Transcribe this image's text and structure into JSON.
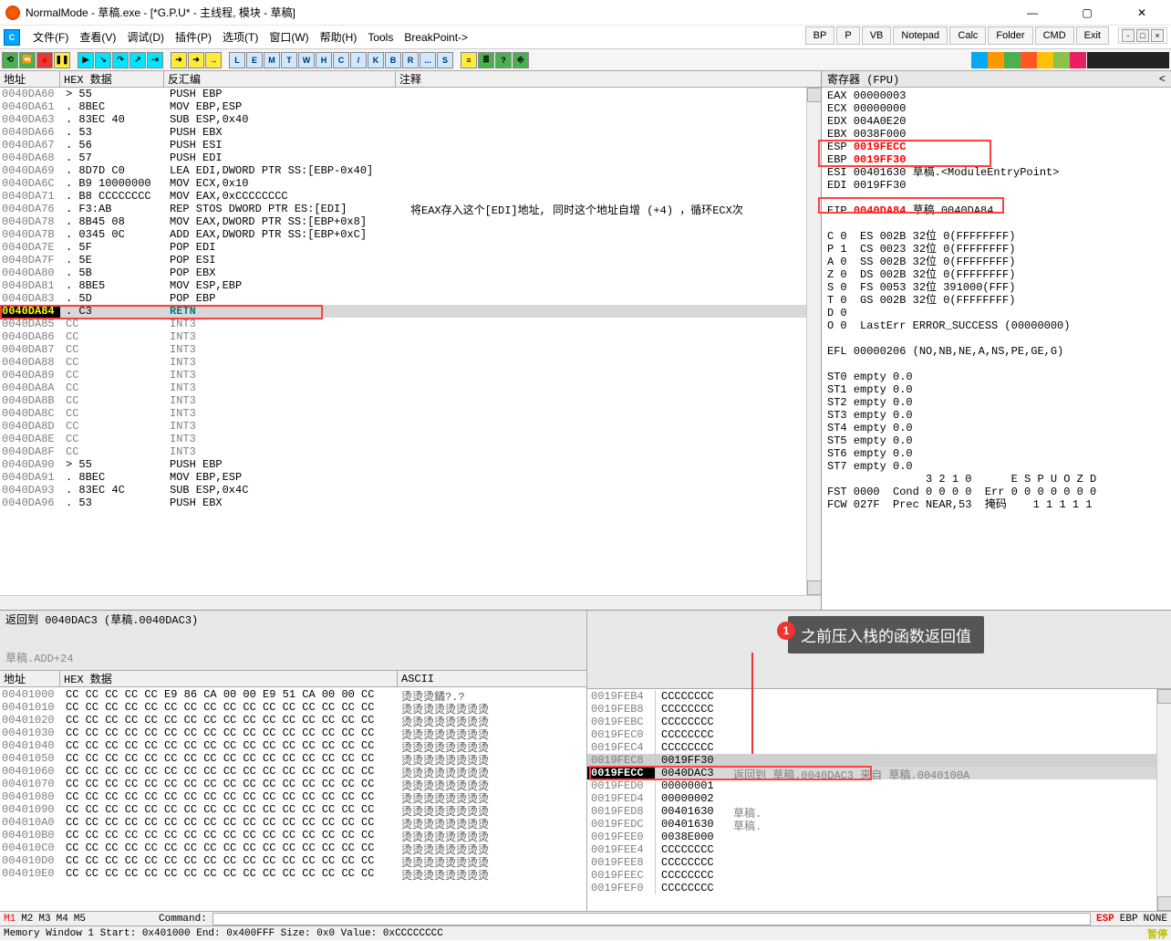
{
  "title": "NormalMode - 草稿.exe - [*G.P.U* - 主线程, 模块 - 草稿]",
  "menu": {
    "file": "文件(F)",
    "view": "查看(V)",
    "debug": "调试(D)",
    "plugin": "插件(P)",
    "options": "选项(T)",
    "window": "窗口(W)",
    "help": "帮助(H)",
    "tools": "Tools",
    "bp": "BreakPoint->"
  },
  "buttons": {
    "bp": "BP",
    "p": "P",
    "vb": "VB",
    "notepad": "Notepad",
    "calc": "Calc",
    "folder": "Folder",
    "cmd": "CMD",
    "exit": "Exit"
  },
  "tbletters": [
    "L",
    "E",
    "M",
    "T",
    "W",
    "H",
    "C",
    "/",
    "K",
    "B",
    "R",
    "...",
    "S"
  ],
  "headers": {
    "addr": "地址",
    "hex": "HEX 数据",
    "disasm": "反汇编",
    "comment": "注释",
    "reg": "寄存器 (FPU)",
    "ascii": "ASCII"
  },
  "comment0": "将EAX存入这个[EDI]地址, 同时这个地址自增 (+4) ，循环ECX次",
  "disasm": [
    {
      "a": "0040DA60",
      "h": "> 55",
      "d": "PUSH EBP"
    },
    {
      "a": "0040DA61",
      "h": ". 8BEC",
      "d": "MOV EBP,ESP"
    },
    {
      "a": "0040DA63",
      "h": ". 83EC 40",
      "d": "SUB ESP,0x40"
    },
    {
      "a": "0040DA66",
      "h": ". 53",
      "d": "PUSH EBX"
    },
    {
      "a": "0040DA67",
      "h": ". 56",
      "d": "PUSH ESI"
    },
    {
      "a": "0040DA68",
      "h": ". 57",
      "d": "PUSH EDI"
    },
    {
      "a": "0040DA69",
      "h": ". 8D7D C0",
      "d": "LEA EDI,DWORD PTR SS:[EBP-0x40]"
    },
    {
      "a": "0040DA6C",
      "h": ". B9 10000000",
      "d": "MOV ECX,0x10"
    },
    {
      "a": "0040DA71",
      "h": ". B8 CCCCCCCC",
      "d": "MOV EAX,0xCCCCCCCC"
    },
    {
      "a": "0040DA76",
      "h": ". F3:AB",
      "d": "REP STOS DWORD PTR ES:[EDI]"
    },
    {
      "a": "0040DA78",
      "h": ". 8B45 08",
      "d": "MOV EAX,DWORD PTR SS:[EBP+0x8]"
    },
    {
      "a": "0040DA7B",
      "h": ". 0345 0C",
      "d": "ADD EAX,DWORD PTR SS:[EBP+0xC]"
    },
    {
      "a": "0040DA7E",
      "h": ". 5F",
      "d": "POP EDI"
    },
    {
      "a": "0040DA7F",
      "h": ". 5E",
      "d": "POP ESI"
    },
    {
      "a": "0040DA80",
      "h": ". 5B",
      "d": "POP EBX"
    },
    {
      "a": "0040DA81",
      "h": ". 8BE5",
      "d": "MOV ESP,EBP"
    },
    {
      "a": "0040DA83",
      "h": ". 5D",
      "d": "POP EBP"
    },
    {
      "a": "0040DA84",
      "h": ". C3",
      "d": "RETN",
      "hl": true
    },
    {
      "a": "0040DA85",
      "h": "  CC",
      "d": "INT3"
    },
    {
      "a": "0040DA86",
      "h": "  CC",
      "d": "INT3"
    },
    {
      "a": "0040DA87",
      "h": "  CC",
      "d": "INT3"
    },
    {
      "a": "0040DA88",
      "h": "  CC",
      "d": "INT3"
    },
    {
      "a": "0040DA89",
      "h": "  CC",
      "d": "INT3"
    },
    {
      "a": "0040DA8A",
      "h": "  CC",
      "d": "INT3"
    },
    {
      "a": "0040DA8B",
      "h": "  CC",
      "d": "INT3"
    },
    {
      "a": "0040DA8C",
      "h": "  CC",
      "d": "INT3"
    },
    {
      "a": "0040DA8D",
      "h": "  CC",
      "d": "INT3"
    },
    {
      "a": "0040DA8E",
      "h": "  CC",
      "d": "INT3"
    },
    {
      "a": "0040DA8F",
      "h": "  CC",
      "d": "INT3"
    },
    {
      "a": "0040DA90",
      "h": "> 55",
      "d": "PUSH EBP"
    },
    {
      "a": "0040DA91",
      "h": ". 8BEC",
      "d": "MOV EBP,ESP"
    },
    {
      "a": "0040DA93",
      "h": ". 83EC 4C",
      "d": "SUB ESP,0x4C"
    },
    {
      "a": "0040DA96",
      "h": ". 53",
      "d": "PUSH EBX"
    }
  ],
  "registers": [
    "EAX 00000003",
    "ECX 00000000",
    "EDX 004A0E20",
    "EBX 0038F000",
    "ESP 0019FECC",
    "EBP 0019FF30",
    "ESI 00401630 草稿.<ModuleEntryPoint>",
    "EDI 0019FF30",
    "",
    "EIP 0040DA84 草稿.0040DA84",
    "",
    "C 0  ES 002B 32位 0(FFFFFFFF)",
    "P 1  CS 0023 32位 0(FFFFFFFF)",
    "A 0  SS 002B 32位 0(FFFFFFFF)",
    "Z 0  DS 002B 32位 0(FFFFFFFF)",
    "S 0  FS 0053 32位 391000(FFF)",
    "T 0  GS 002B 32位 0(FFFFFFFF)",
    "D 0",
    "O 0  LastErr ERROR_SUCCESS (00000000)",
    "",
    "EFL 00000206 (NO,NB,NE,A,NS,PE,GE,G)",
    "",
    "ST0 empty 0.0",
    "ST1 empty 0.0",
    "ST2 empty 0.0",
    "ST3 empty 0.0",
    "ST4 empty 0.0",
    "ST5 empty 0.0",
    "ST6 empty 0.0",
    "ST7 empty 0.0",
    "               3 2 1 0      E S P U O Z D",
    "FST 0000  Cond 0 0 0 0  Err 0 0 0 0 0 0 0",
    "FCW 027F  Prec NEAR,53  掩码    1 1 1 1 1"
  ],
  "info": {
    "ret": "返回到 0040DAC3 (草稿.0040DAC3)",
    "add": "草稿.ADD+24"
  },
  "hexrows": [
    {
      "a": "00401000",
      "h": "CC CC CC CC CC E9 86 CA  00 00 E9 51  CA 00 00 CC",
      "s": "烫烫烫鐍?.?"
    },
    {
      "a": "00401010",
      "h": "CC CC CC CC CC CC CC CC  CC CC CC CC  CC CC CC CC",
      "s": "烫烫烫烫烫烫烫烫"
    },
    {
      "a": "00401020",
      "h": "CC CC CC CC CC CC CC CC  CC CC CC CC  CC CC CC CC",
      "s": "烫烫烫烫烫烫烫烫"
    },
    {
      "a": "00401030",
      "h": "CC CC CC CC CC CC CC CC  CC CC CC CC  CC CC CC CC",
      "s": "烫烫烫烫烫烫烫烫"
    },
    {
      "a": "00401040",
      "h": "CC CC CC CC CC CC CC CC  CC CC CC CC  CC CC CC CC",
      "s": "烫烫烫烫烫烫烫烫"
    },
    {
      "a": "00401050",
      "h": "CC CC CC CC CC CC CC CC  CC CC CC CC  CC CC CC CC",
      "s": "烫烫烫烫烫烫烫烫"
    },
    {
      "a": "00401060",
      "h": "CC CC CC CC CC CC CC CC  CC CC CC CC  CC CC CC CC",
      "s": "烫烫烫烫烫烫烫烫"
    },
    {
      "a": "00401070",
      "h": "CC CC CC CC CC CC CC CC  CC CC CC CC  CC CC CC CC",
      "s": "烫烫烫烫烫烫烫烫"
    },
    {
      "a": "00401080",
      "h": "CC CC CC CC CC CC CC CC  CC CC CC CC  CC CC CC CC",
      "s": "烫烫烫烫烫烫烫烫"
    },
    {
      "a": "00401090",
      "h": "CC CC CC CC CC CC CC CC  CC CC CC CC  CC CC CC CC",
      "s": "烫烫烫烫烫烫烫烫"
    },
    {
      "a": "004010A0",
      "h": "CC CC CC CC CC CC CC CC  CC CC CC CC  CC CC CC CC",
      "s": "烫烫烫烫烫烫烫烫"
    },
    {
      "a": "004010B0",
      "h": "CC CC CC CC CC CC CC CC  CC CC CC CC  CC CC CC CC",
      "s": "烫烫烫烫烫烫烫烫"
    },
    {
      "a": "004010C0",
      "h": "CC CC CC CC CC CC CC CC  CC CC CC CC  CC CC CC CC",
      "s": "烫烫烫烫烫烫烫烫"
    },
    {
      "a": "004010D0",
      "h": "CC CC CC CC CC CC CC CC  CC CC CC CC  CC CC CC CC",
      "s": "烫烫烫烫烫烫烫烫"
    },
    {
      "a": "004010E0",
      "h": "CC CC CC CC CC CC CC CC  CC CC CC CC  CC CC CC CC",
      "s": "烫烫烫烫烫烫烫烫"
    }
  ],
  "stack": [
    {
      "a": "0019FEB4",
      "v": "CCCCCCCC",
      "c": ""
    },
    {
      "a": "0019FEB8",
      "v": "CCCCCCCC",
      "c": ""
    },
    {
      "a": "0019FEBC",
      "v": "CCCCCCCC",
      "c": ""
    },
    {
      "a": "0019FEC0",
      "v": "CCCCCCCC",
      "c": ""
    },
    {
      "a": "0019FEC4",
      "v": "CCCCCCCC",
      "c": ""
    },
    {
      "a": "0019FEC8",
      "v": "0019FF30",
      "c": "",
      "hl": "gray"
    },
    {
      "a": "0019FECC",
      "v": "0040DAC3",
      "c": "返回到 草稿.0040DAC3 来自 草稿.0040100A",
      "hl": "sel"
    },
    {
      "a": "0019FED0",
      "v": "00000001",
      "c": ""
    },
    {
      "a": "0019FED4",
      "v": "00000002",
      "c": ""
    },
    {
      "a": "0019FED8",
      "v": "00401630",
      "c": "草稿.<ModuleEntryPoint>"
    },
    {
      "a": "0019FEDC",
      "v": "00401630",
      "c": "草稿.<ModuleEntryPoint>"
    },
    {
      "a": "0019FEE0",
      "v": "0038E000",
      "c": ""
    },
    {
      "a": "0019FEE4",
      "v": "CCCCCCCC",
      "c": ""
    },
    {
      "a": "0019FEE8",
      "v": "CCCCCCCC",
      "c": ""
    },
    {
      "a": "0019FEEC",
      "v": "CCCCCCCC",
      "c": ""
    },
    {
      "a": "0019FEF0",
      "v": "CCCCCCCC",
      "c": ""
    }
  ],
  "status1": {
    "m1": "M1",
    "m2": "M2",
    "m3": "M3",
    "m4": "M4",
    "m5": "M5",
    "cmd": "Command:",
    "esp": "ESP",
    "ebp": "EBP",
    "none": "NONE"
  },
  "status2": "Memory Window 1  Start: 0x401000  End: 0x400FFF  Size: 0x0 Value: 0xCCCCCCCC",
  "status2pause": "暂停",
  "annot": "之前压入栈的函数返回值"
}
